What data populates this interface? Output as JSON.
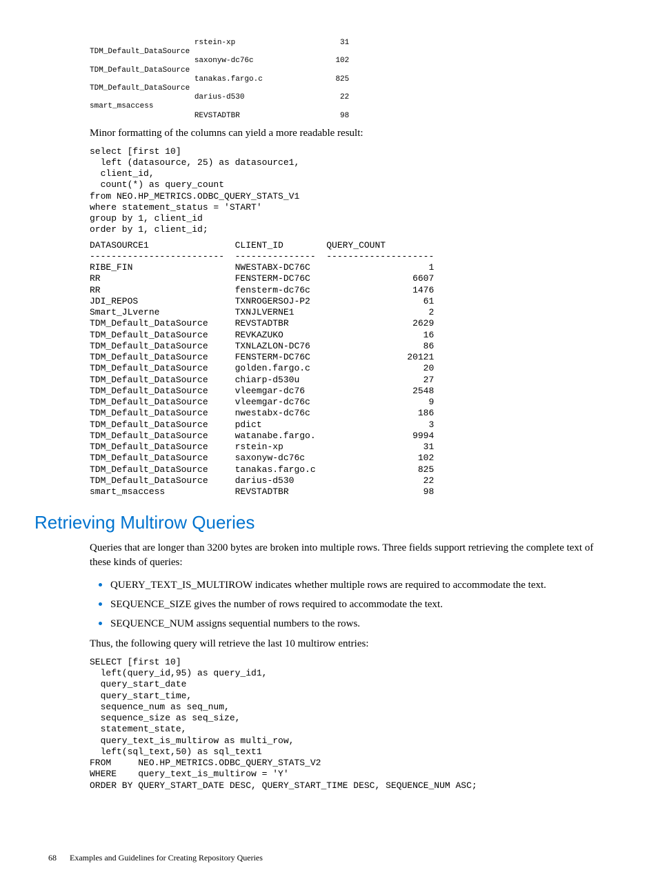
{
  "topBlock": "                       rstein-xp                       31\nTDM_Default_DataSource\n                       saxonyw-dc76c                  102\nTDM_Default_DataSource\n                       tanakas.fargo.c                825\nTDM_Default_DataSource\n                       darius-d530                     22\nsmart_msaccess\n                       REVSTADTBR                      98",
  "para1": "Minor formatting of the columns can yield a more readable result:",
  "sql1": "select [first 10]\n  left (datasource, 25) as datasource1,\n  client_id,\n  count(*) as query_count\nfrom NEO.HP_METRICS.ODBC_QUERY_STATS_V1\nwhere statement_status = 'START'\ngroup by 1, client_id\norder by 1, client_id;",
  "table1": "DATASOURCE1                CLIENT_ID        QUERY_COUNT\n-------------------------  ---------------  --------------------\nRIBE_FIN                   NWESTABX-DC76C                      1\nRR                         FENSTERM-DC76C                   6607\nRR                         fensterm-dc76c                   1476\nJDI_REPOS                  TXNROGERSOJ-P2                     61\nSmart_JLverne              TXNJLVERNE1                         2\nTDM_Default_DataSource     REVSTADTBR                       2629\nTDM_Default_DataSource     REVKAZUKO                          16\nTDM_Default_DataSource     TXNLAZLON-DC76                     86\nTDM_Default_DataSource     FENSTERM-DC76C                  20121\nTDM_Default_DataSource     golden.fargo.c                     20\nTDM_Default_DataSource     chiarp-d530u                       27\nTDM_Default_DataSource     vleemgar-dc76                    2548\nTDM_Default_DataSource     vleemgar-dc76c                      9\nTDM_Default_DataSource     nwestabx-dc76c                    186\nTDM_Default_DataSource     pdict                               3\nTDM_Default_DataSource     watanabe.fargo.                  9994\nTDM_Default_DataSource     rstein-xp                          31\nTDM_Default_DataSource     saxonyw-dc76c                     102\nTDM_Default_DataSource     tanakas.fargo.c                   825\nTDM_Default_DataSource     darius-d530                        22\nsmart_msaccess             REVSTADTBR                         98",
  "heading": "Retrieving Multirow Queries",
  "para2": "Queries that are longer than 3200 bytes are broken into multiple rows. Three fields support retrieving the complete text of these kinds of queries:",
  "bullets": [
    "QUERY_TEXT_IS_MULTIROW indicates whether multiple rows are required to accommodate the text.",
    "SEQUENCE_SIZE gives the number of rows required to accommodate the text.",
    "SEQUENCE_NUM assigns sequential numbers to the rows."
  ],
  "para3": "Thus, the following query will retrieve the last 10 multirow entries:",
  "sql2": "SELECT [first 10]\n  left(query_id,95) as query_id1,\n  query_start_date\n  query_start_time,\n  sequence_num as seq_num,\n  sequence_size as seq_size,\n  statement_state,\n  query_text_is_multirow as multi_row,\n  left(sql_text,50) as sql_text1\nFROM     NEO.HP_METRICS.ODBC_QUERY_STATS_V2\nWHERE    query_text_is_multirow = 'Y'\nORDER BY QUERY_START_DATE DESC, QUERY_START_TIME DESC, SEQUENCE_NUM ASC;",
  "footer": {
    "pageNum": "68",
    "chapter": "Examples and Guidelines for Creating Repository Queries"
  }
}
